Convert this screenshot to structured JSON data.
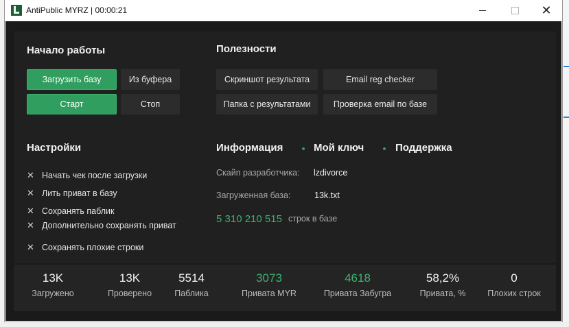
{
  "window": {
    "title": "AntiPublic MYRZ | 00:00:21"
  },
  "start_section": {
    "heading": "Начало работы",
    "buttons": {
      "load_base": "Загрузить базу",
      "from_clipboard": "Из буфера",
      "start": "Старт",
      "stop": "Стоп"
    }
  },
  "utilities_section": {
    "heading": "Полезности",
    "buttons": {
      "screenshot": "Скриншот результата",
      "email_reg": "Email reg checker",
      "results_folder": "Папка с результатами",
      "email_check": "Проверка email по базе"
    }
  },
  "settings_section": {
    "heading": "Настройки",
    "options": [
      {
        "label": "Начать чек после загрузки",
        "checked": false
      },
      {
        "label": "Лить приват в базу",
        "checked": false
      },
      {
        "label": "Сохранять паблик",
        "checked": false
      },
      {
        "label": "Дополнительно сохранять приват",
        "checked": false
      },
      {
        "label": "Сохранять плохие строки",
        "checked": false
      }
    ]
  },
  "info_section": {
    "tabs": [
      "Информация",
      "Мой ключ",
      "Поддержка"
    ],
    "dev_skype_label": "Скайп разработчика:",
    "dev_skype_value": "lzdivorce",
    "loaded_base_label": "Загруженная база:",
    "loaded_base_value": "13k.txt",
    "rows_count": "5 310 210 515",
    "rows_suffix": "строк в базе"
  },
  "stats": [
    {
      "value": "13K",
      "label": "Загружено",
      "highlight": false
    },
    {
      "value": "13K",
      "label": "Проверено",
      "highlight": false
    },
    {
      "value": "5514",
      "label": "Паблика",
      "highlight": false
    },
    {
      "value": "3073",
      "label": "Привата MYR",
      "highlight": true
    },
    {
      "value": "4618",
      "label": "Привата Забугра",
      "highlight": true
    },
    {
      "value": "58,2%",
      "label": "Привата, %",
      "highlight": false
    },
    {
      "value": "0",
      "label": "Плохих строк",
      "highlight": false
    }
  ],
  "colors": {
    "accent": "#2f9e5e",
    "accent_text": "#3bb36f",
    "background": "#1a1a1a",
    "panel": "#202020"
  }
}
